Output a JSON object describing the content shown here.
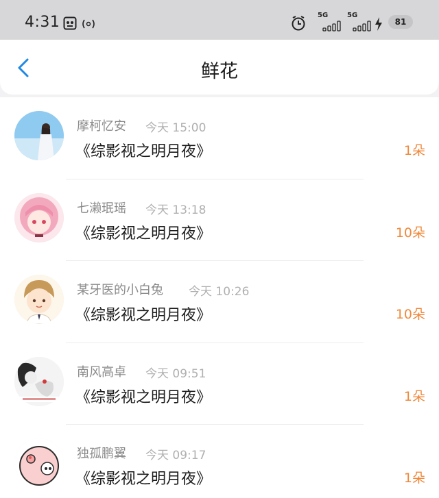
{
  "status_bar": {
    "time": "4:31",
    "network_1": "5G",
    "network_2": "5G",
    "battery": "81",
    "icons": [
      "screen-record-icon",
      "hotspot-icon",
      "alarm-icon",
      "signal-icon",
      "signal-icon",
      "charging-icon",
      "battery-icon"
    ]
  },
  "header": {
    "title": "鲜花",
    "back_icon": "chevron-left-icon",
    "accent": "#1e88e5"
  },
  "items": [
    {
      "name": "摩柯忆安",
      "time": "今天 15:00",
      "book": "《综影视之明月夜》",
      "count": "1朵"
    },
    {
      "name": "七濑珉瑶",
      "time": "今天 13:18",
      "book": "《综影视之明月夜》",
      "count": "10朵"
    },
    {
      "name": "某牙医的小白兔",
      "time": "今天 10:26",
      "book": "《综影视之明月夜》",
      "count": "10朵"
    },
    {
      "name": "南风高卓",
      "time": "今天 09:51",
      "book": "《综影视之明月夜》",
      "count": "1朵"
    },
    {
      "name": "独孤鹏翼",
      "time": "今天 09:17",
      "book": "《综影视之明月夜》",
      "count": "1朵"
    }
  ],
  "colors": {
    "count": "#f0883a",
    "name": "#8a8a8a",
    "time": "#b0b0b0"
  }
}
